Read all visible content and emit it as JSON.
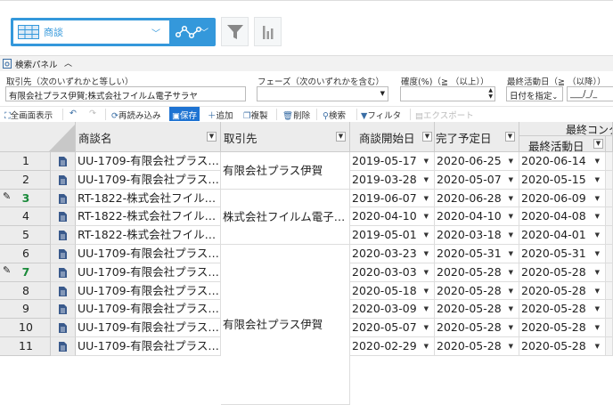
{
  "topbar": {
    "app_name": "商談",
    "icons": [
      "table-icon",
      "chevron-down-icon",
      "process-icon",
      "chevron-down-icon",
      "funnel-icon",
      "bar-chart-icon"
    ],
    "accent": "#3498db"
  },
  "search_panel": {
    "title": "検索パネル",
    "fields": [
      {
        "label": "取引先（次のいずれかと等しい）",
        "value": "有限会社プラス伊賀;株式会社フイルム電子サラヤ"
      },
      {
        "label": "フェーズ（次のいずれかを含む）",
        "value": ""
      },
      {
        "label": "確度(%)（≧ （以上））",
        "value": ""
      },
      {
        "label": "最終活動日（≧ （以降））",
        "select": "日付を指定",
        "date": "___/_/_"
      }
    ]
  },
  "toolbar": {
    "fullscreen": "全画面表示",
    "reload": "再読み込み",
    "save": "保存",
    "add": "追加",
    "duplicate": "複製",
    "delete": "削除",
    "search": "検索",
    "filter": "フィルタ",
    "export": "エクスポート"
  },
  "grid": {
    "group_header": "最終コンタ",
    "columns": [
      "商談名",
      "取引先",
      "商談開始日",
      "完了予定日",
      "最終活動日"
    ],
    "accounts": [
      "有限会社プラス伊賀",
      "株式会社フイルム電子…",
      "有限会社プラス伊賀"
    ],
    "rows": [
      {
        "n": "1",
        "name": "UU-1709-有限会社プラス…",
        "start": "2019-05-17",
        "due": "2020-06-25",
        "last": "2020-06-14",
        "edit": false
      },
      {
        "n": "2",
        "name": "UU-1709-有限会社プラス…",
        "start": "2019-03-28",
        "due": "2020-05-07",
        "last": "2020-05-15",
        "edit": false
      },
      {
        "n": "3",
        "name": "RT-1822-株式会社フイル…",
        "start": "2019-06-07",
        "due": "2020-06-28",
        "last": "2020-06-09",
        "edit": true
      },
      {
        "n": "4",
        "name": "RT-1822-株式会社フイル…",
        "start": "2020-04-10",
        "due": "2020-04-10",
        "last": "2020-04-08",
        "edit": false
      },
      {
        "n": "5",
        "name": "RT-1822-株式会社フイル…",
        "start": "2019-05-01",
        "due": "2020-03-18",
        "last": "2020-04-01",
        "edit": false
      },
      {
        "n": "6",
        "name": "UU-1709-有限会社プラス…",
        "start": "2020-03-23",
        "due": "2020-05-31",
        "last": "2020-05-31",
        "edit": false
      },
      {
        "n": "7",
        "name": "UU-1709-有限会社プラス…",
        "start": "2020-03-03",
        "due": "2020-05-28",
        "last": "2020-05-28",
        "edit": true
      },
      {
        "n": "8",
        "name": "UU-1709-有限会社プラス…",
        "start": "2020-05-18",
        "due": "2020-05-28",
        "last": "2020-05-28",
        "edit": false
      },
      {
        "n": "9",
        "name": "UU-1709-有限会社プラス…",
        "start": "2020-03-09",
        "due": "2020-05-28",
        "last": "2020-05-28",
        "edit": false
      },
      {
        "n": "10",
        "name": "UU-1709-有限会社プラス…",
        "start": "2020-05-07",
        "due": "2020-05-28",
        "last": "2020-05-28",
        "edit": false
      },
      {
        "n": "11",
        "name": "UU-1709-有限会社プラス…",
        "start": "2020-02-29",
        "due": "2020-05-28",
        "last": "2020-05-28",
        "edit": false
      }
    ]
  }
}
